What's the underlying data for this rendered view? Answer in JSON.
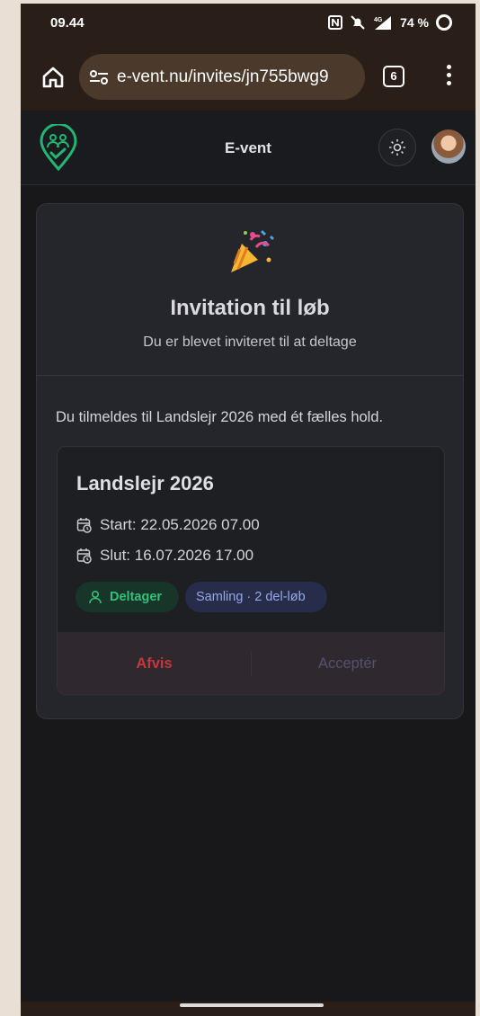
{
  "status_bar": {
    "time": "09.44",
    "signal_label": "4G",
    "battery": "74 %"
  },
  "browser": {
    "url": "e-vent.nu/invites/jn755bwg9",
    "tab_count": "6"
  },
  "app": {
    "title": "E-vent"
  },
  "invite": {
    "title": "Invitation til løb",
    "subtitle": "Du er blevet inviteret til at deltage",
    "info": "Du tilmeldes til Landslejr 2026 med ét fælles hold.",
    "event": {
      "name": "Landslejr 2026",
      "start": "Start: 22.05.2026 07.00",
      "end": "Slut: 16.07.2026 17.00",
      "role_chip": "Deltager",
      "collection_chip": "Samling · 2 del-løb"
    },
    "actions": {
      "reject": "Afvis",
      "accept": "Acceptér"
    }
  },
  "colors": {
    "accent_green": "#34c07a",
    "reject_red": "#c03a3a",
    "chip_blue": "#9ba7e4",
    "browser_bar": "#2a1f18"
  }
}
